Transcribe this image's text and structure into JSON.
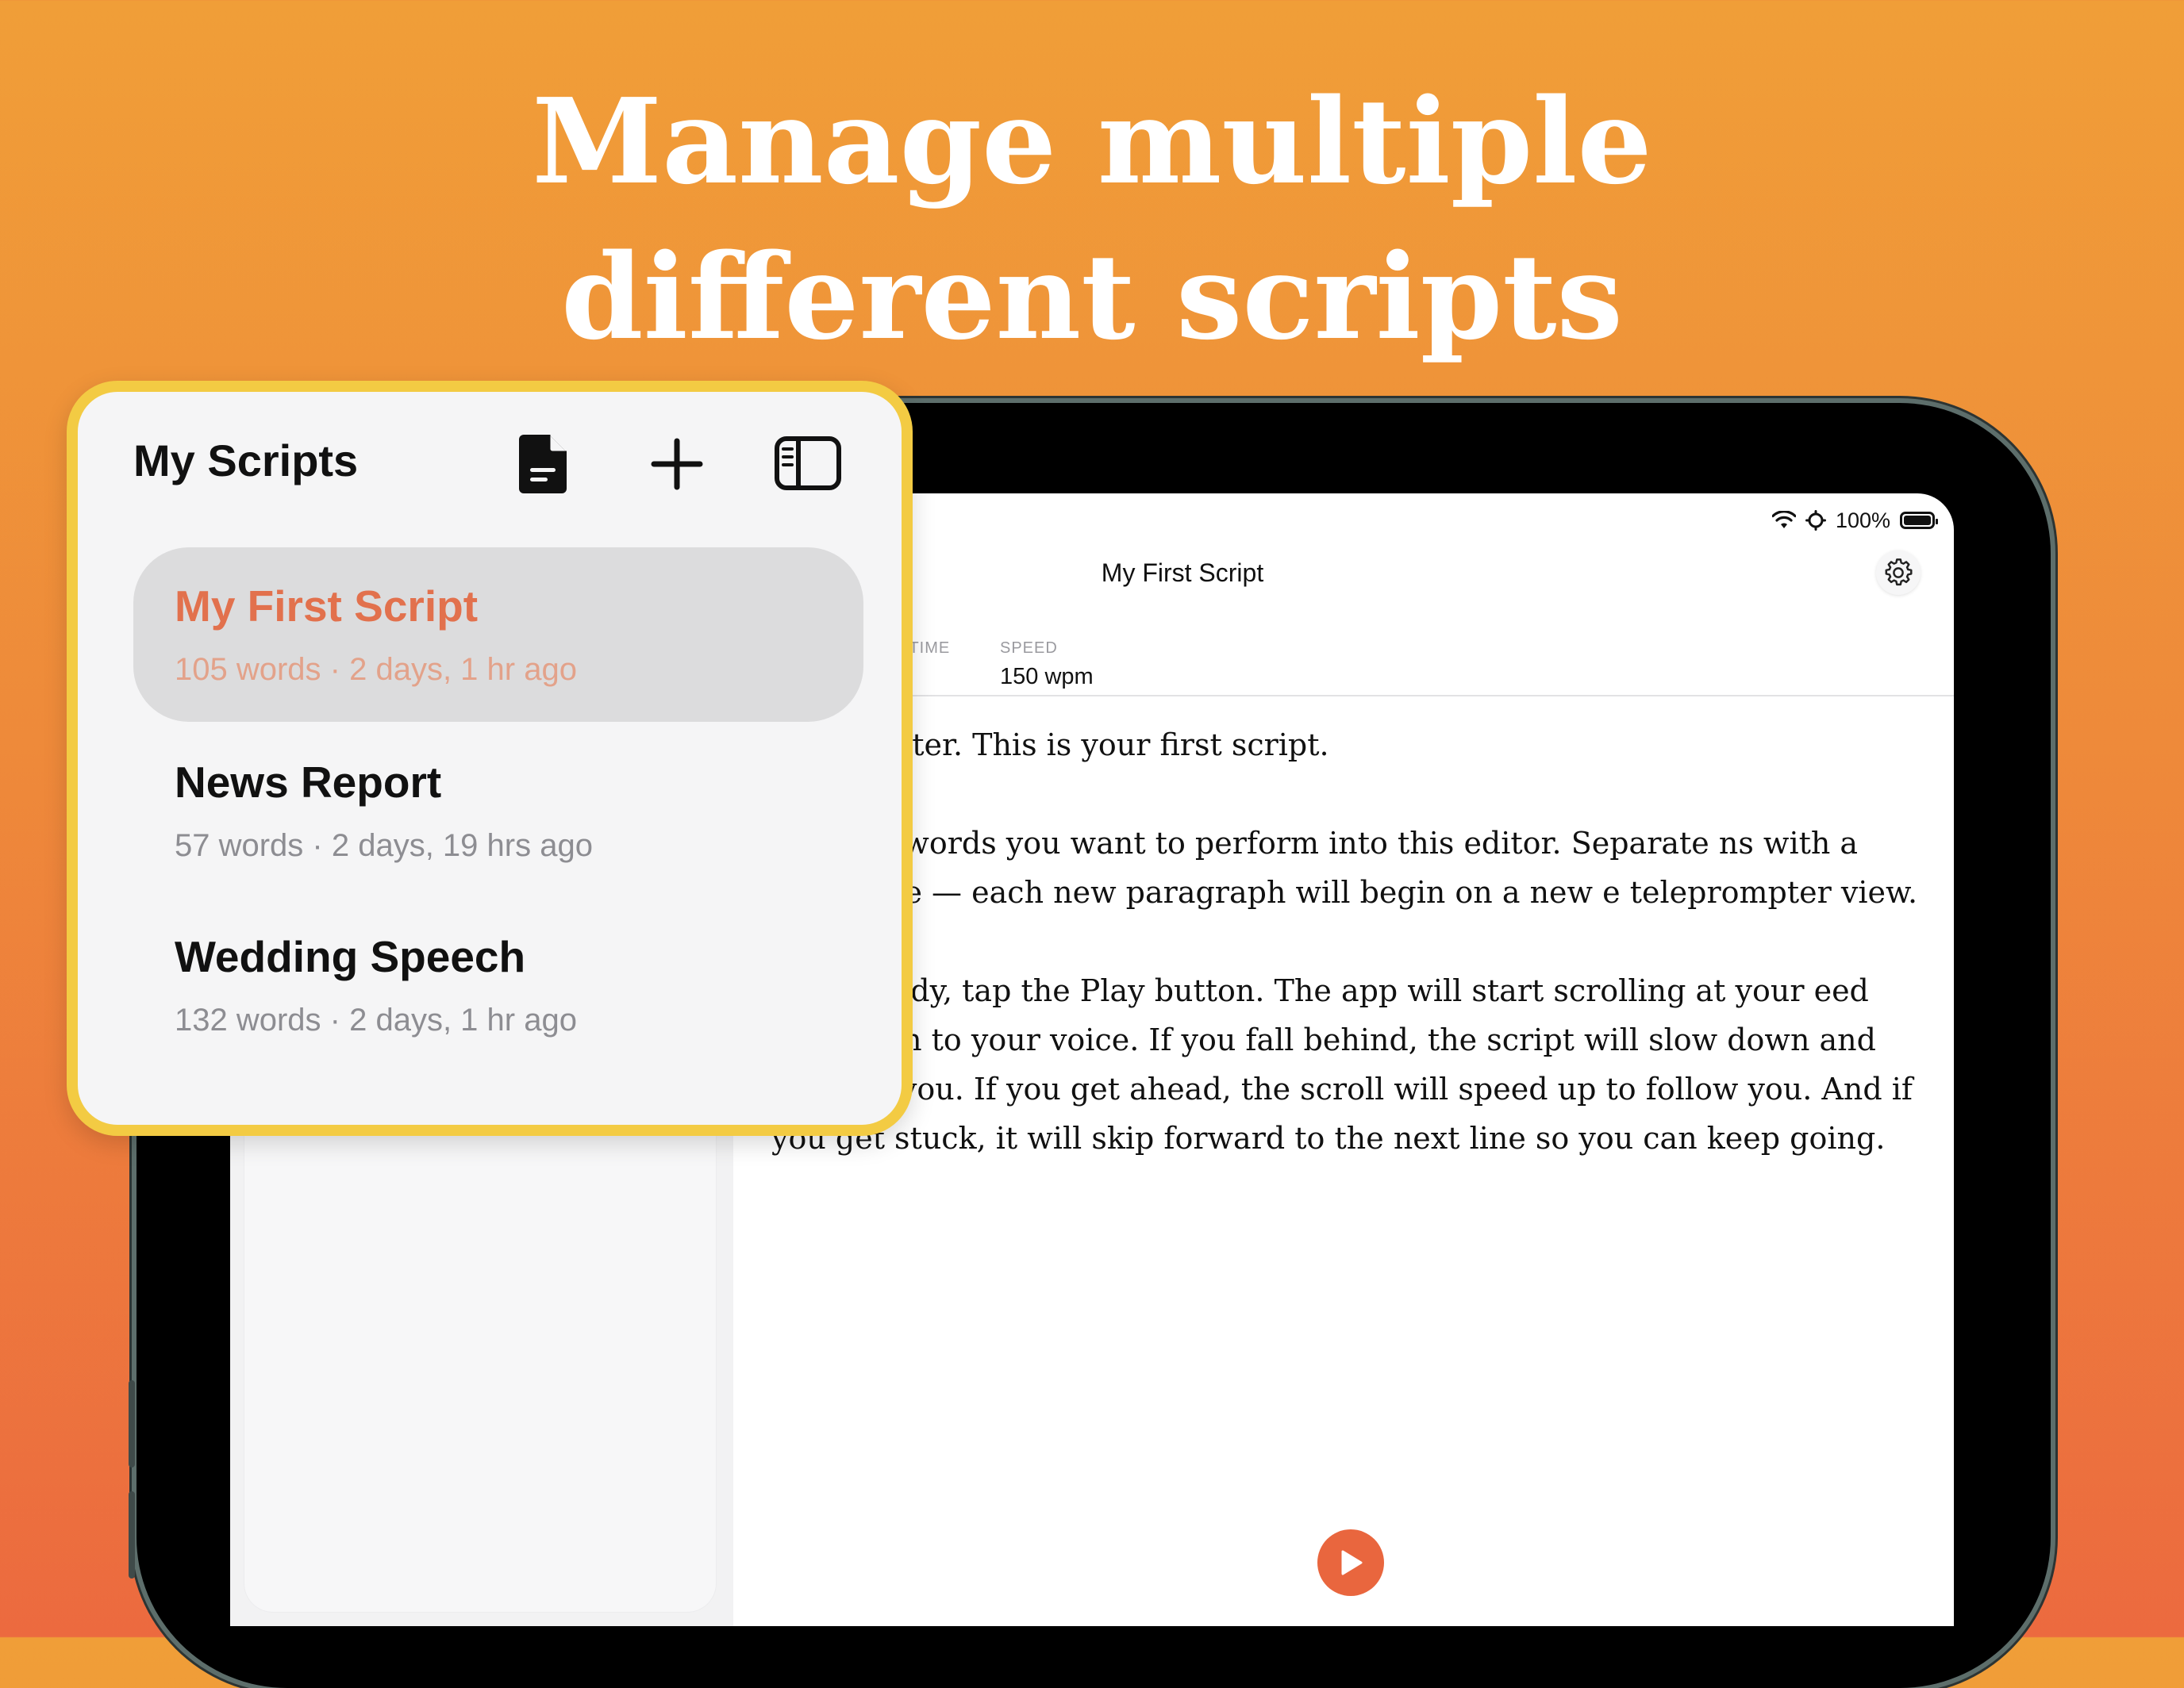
{
  "headline": {
    "line1": "Manage multiple",
    "line2": "different scripts"
  },
  "status_bar": {
    "battery": "100%",
    "icons": [
      "wifi-icon",
      "focus-icon",
      "battery-icon"
    ]
  },
  "editor": {
    "title": "My First Script",
    "stats": [
      {
        "label": "NTIME",
        "value": ""
      },
      {
        "label": "SPEED",
        "value": "150 wpm"
      }
    ],
    "paragraphs": [
      "to Prompter. This is your first script.",
      "aste the words you want to perform into this editor. Separate ns with a blank line — each new paragraph will begin on a new e teleprompter view.",
      "u are ready, tap the Play button. The app will start scrolling at your eed and listen to your voice. If you fall behind, the script will slow down and wait for you. If you get ahead, the scroll will speed up to follow you. And if you get stuck, it will skip forward to the next line so you can keep going."
    ]
  },
  "scripts_panel": {
    "title": "My Scripts",
    "toolbar_icons": [
      "document-icon",
      "plus-icon",
      "sidebar-icon"
    ],
    "items": [
      {
        "title": "My First Script",
        "meta": "105 words · 2 days, 1 hr ago",
        "selected": true
      },
      {
        "title": "News Report",
        "meta": "57 words · 2 days, 19 hrs ago",
        "selected": false
      },
      {
        "title": "Wedding Speech",
        "meta": "132 words · 2 days, 1 hr ago",
        "selected": false
      }
    ]
  },
  "colors": {
    "accent": "#E9663E",
    "highlight_border": "#F3CB43",
    "background_top": "#F09E38",
    "background_bottom": "#EC6A3F"
  }
}
